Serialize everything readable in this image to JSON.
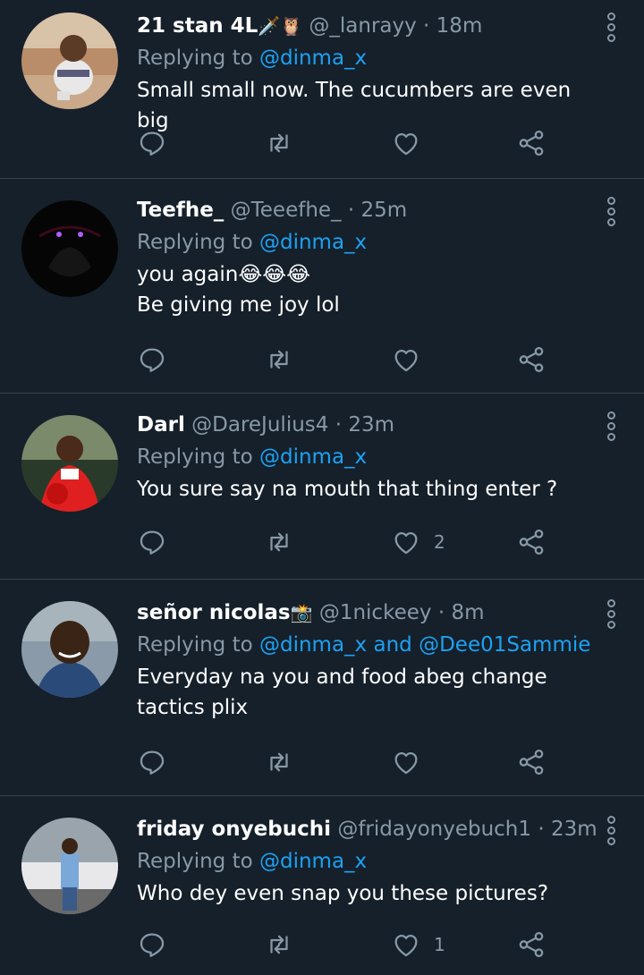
{
  "tweets": [
    {
      "name": "21 stan 4L",
      "name_emoji": "🗡️🦉",
      "handle": "@_lanrayy",
      "time": "18m",
      "replying_prefix": "Replying to",
      "mentions": [
        "@dinma_x"
      ],
      "mention_joiner": "",
      "text_lines": [
        "Small small now. The cucumbers are even big"
      ],
      "like_count": ""
    },
    {
      "name": "Teefhe_",
      "name_emoji": "",
      "handle": "@Teeefhe_",
      "time": "25m",
      "replying_prefix": "Replying to",
      "mentions": [
        "@dinma_x"
      ],
      "mention_joiner": "",
      "text_lines": [
        "you again😂😂😂",
        "Be giving me joy lol"
      ],
      "like_count": ""
    },
    {
      "name": "Darl",
      "name_emoji": "",
      "handle": "@DareJulius4",
      "time": "23m",
      "replying_prefix": "Replying to",
      "mentions": [
        "@dinma_x"
      ],
      "mention_joiner": "",
      "text_lines": [
        "You sure say na mouth that thing enter ?"
      ],
      "like_count": "2"
    },
    {
      "name": "señor nicolas",
      "name_emoji": "📸",
      "handle": "@1nickeey",
      "time": "8m",
      "replying_prefix": "Replying to",
      "mentions": [
        "@dinma_x",
        "@Dee01Sammie"
      ],
      "mention_joiner": "and",
      "text_lines": [
        "Everyday na you and food abeg change tactics plix"
      ],
      "like_count": ""
    },
    {
      "name": "friday onyebuchi",
      "name_emoji": "",
      "handle": "@fridayonyebuch1",
      "time": "23m",
      "replying_prefix": "Replying to",
      "mentions": [
        "@dinma_x"
      ],
      "mention_joiner": "",
      "text_lines": [
        "Who dey even snap you these pictures?"
      ],
      "like_count": "1"
    }
  ],
  "separator": "·",
  "icons": {
    "reply": "reply-icon",
    "retweet": "retweet-icon",
    "like": "heart-icon",
    "share": "share-icon",
    "more": "more-vertical-icon"
  },
  "colors": {
    "background": "#15202b",
    "text": "#ffffff",
    "muted": "#8899a6",
    "accent": "#1da1f2",
    "divider": "#38444d"
  }
}
